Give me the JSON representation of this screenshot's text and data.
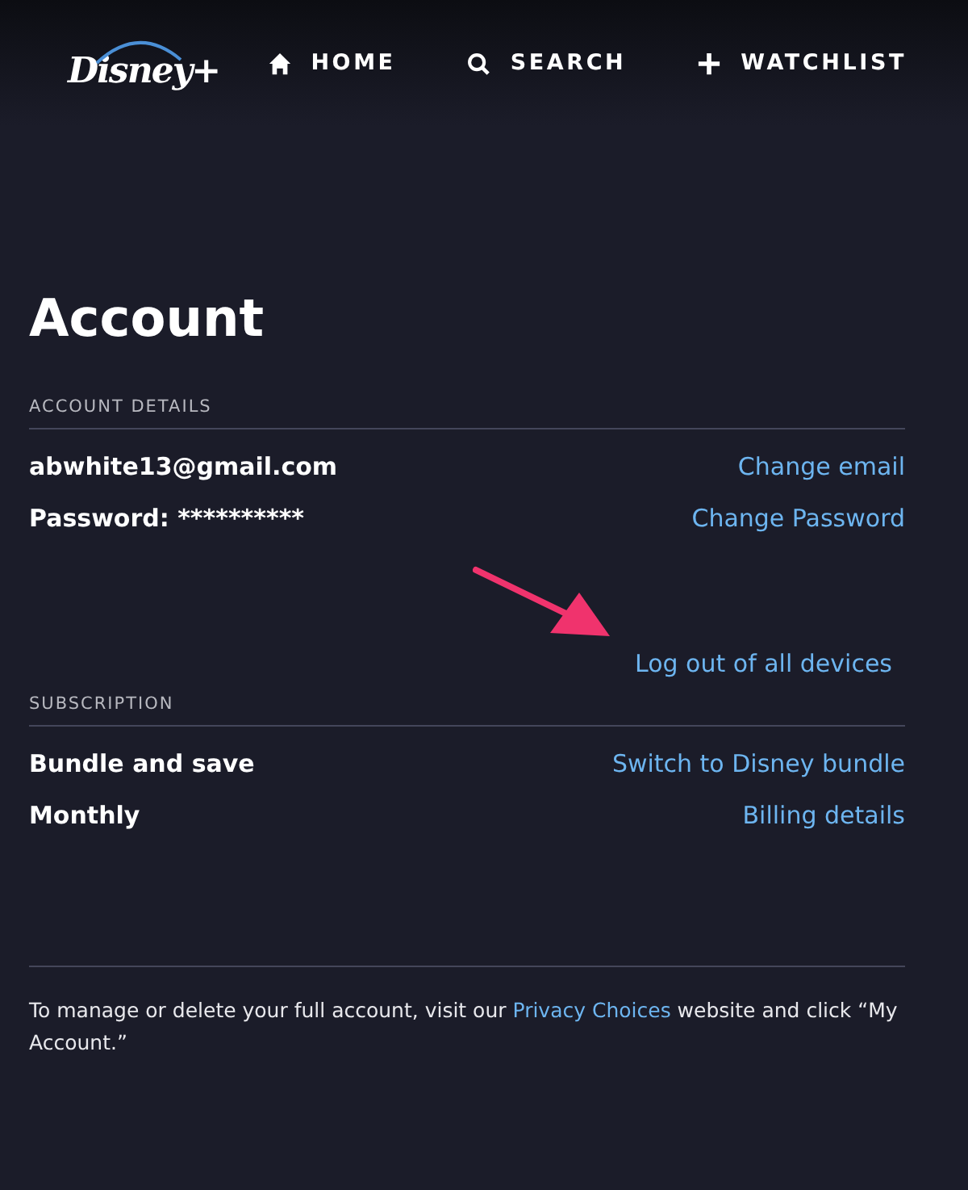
{
  "nav": {
    "logo": "Disney+",
    "items": [
      {
        "kind": "home",
        "label": "HOME"
      },
      {
        "kind": "search",
        "label": "SEARCH"
      },
      {
        "kind": "plus",
        "label": "WATCHLIST"
      }
    ]
  },
  "title": "Account",
  "sections": [
    {
      "heading": "ACCOUNT DETAILS",
      "rows": [
        {
          "label": "abwhite13@gmail.com",
          "action": "Change email"
        },
        {
          "label": "Password: **********",
          "action": "Change Password"
        }
      ],
      "extra_action": "Log out of all devices"
    },
    {
      "heading": "SUBSCRIPTION",
      "rows": [
        {
          "label": "Bundle and save",
          "action": "Switch to Disney bundle"
        },
        {
          "label": "Monthly",
          "action": "Billing details"
        }
      ]
    }
  ],
  "footer": {
    "before": "To manage or delete your full account, visit our ",
    "link": "Privacy Choices",
    "after": " website and click “My Account.”"
  }
}
